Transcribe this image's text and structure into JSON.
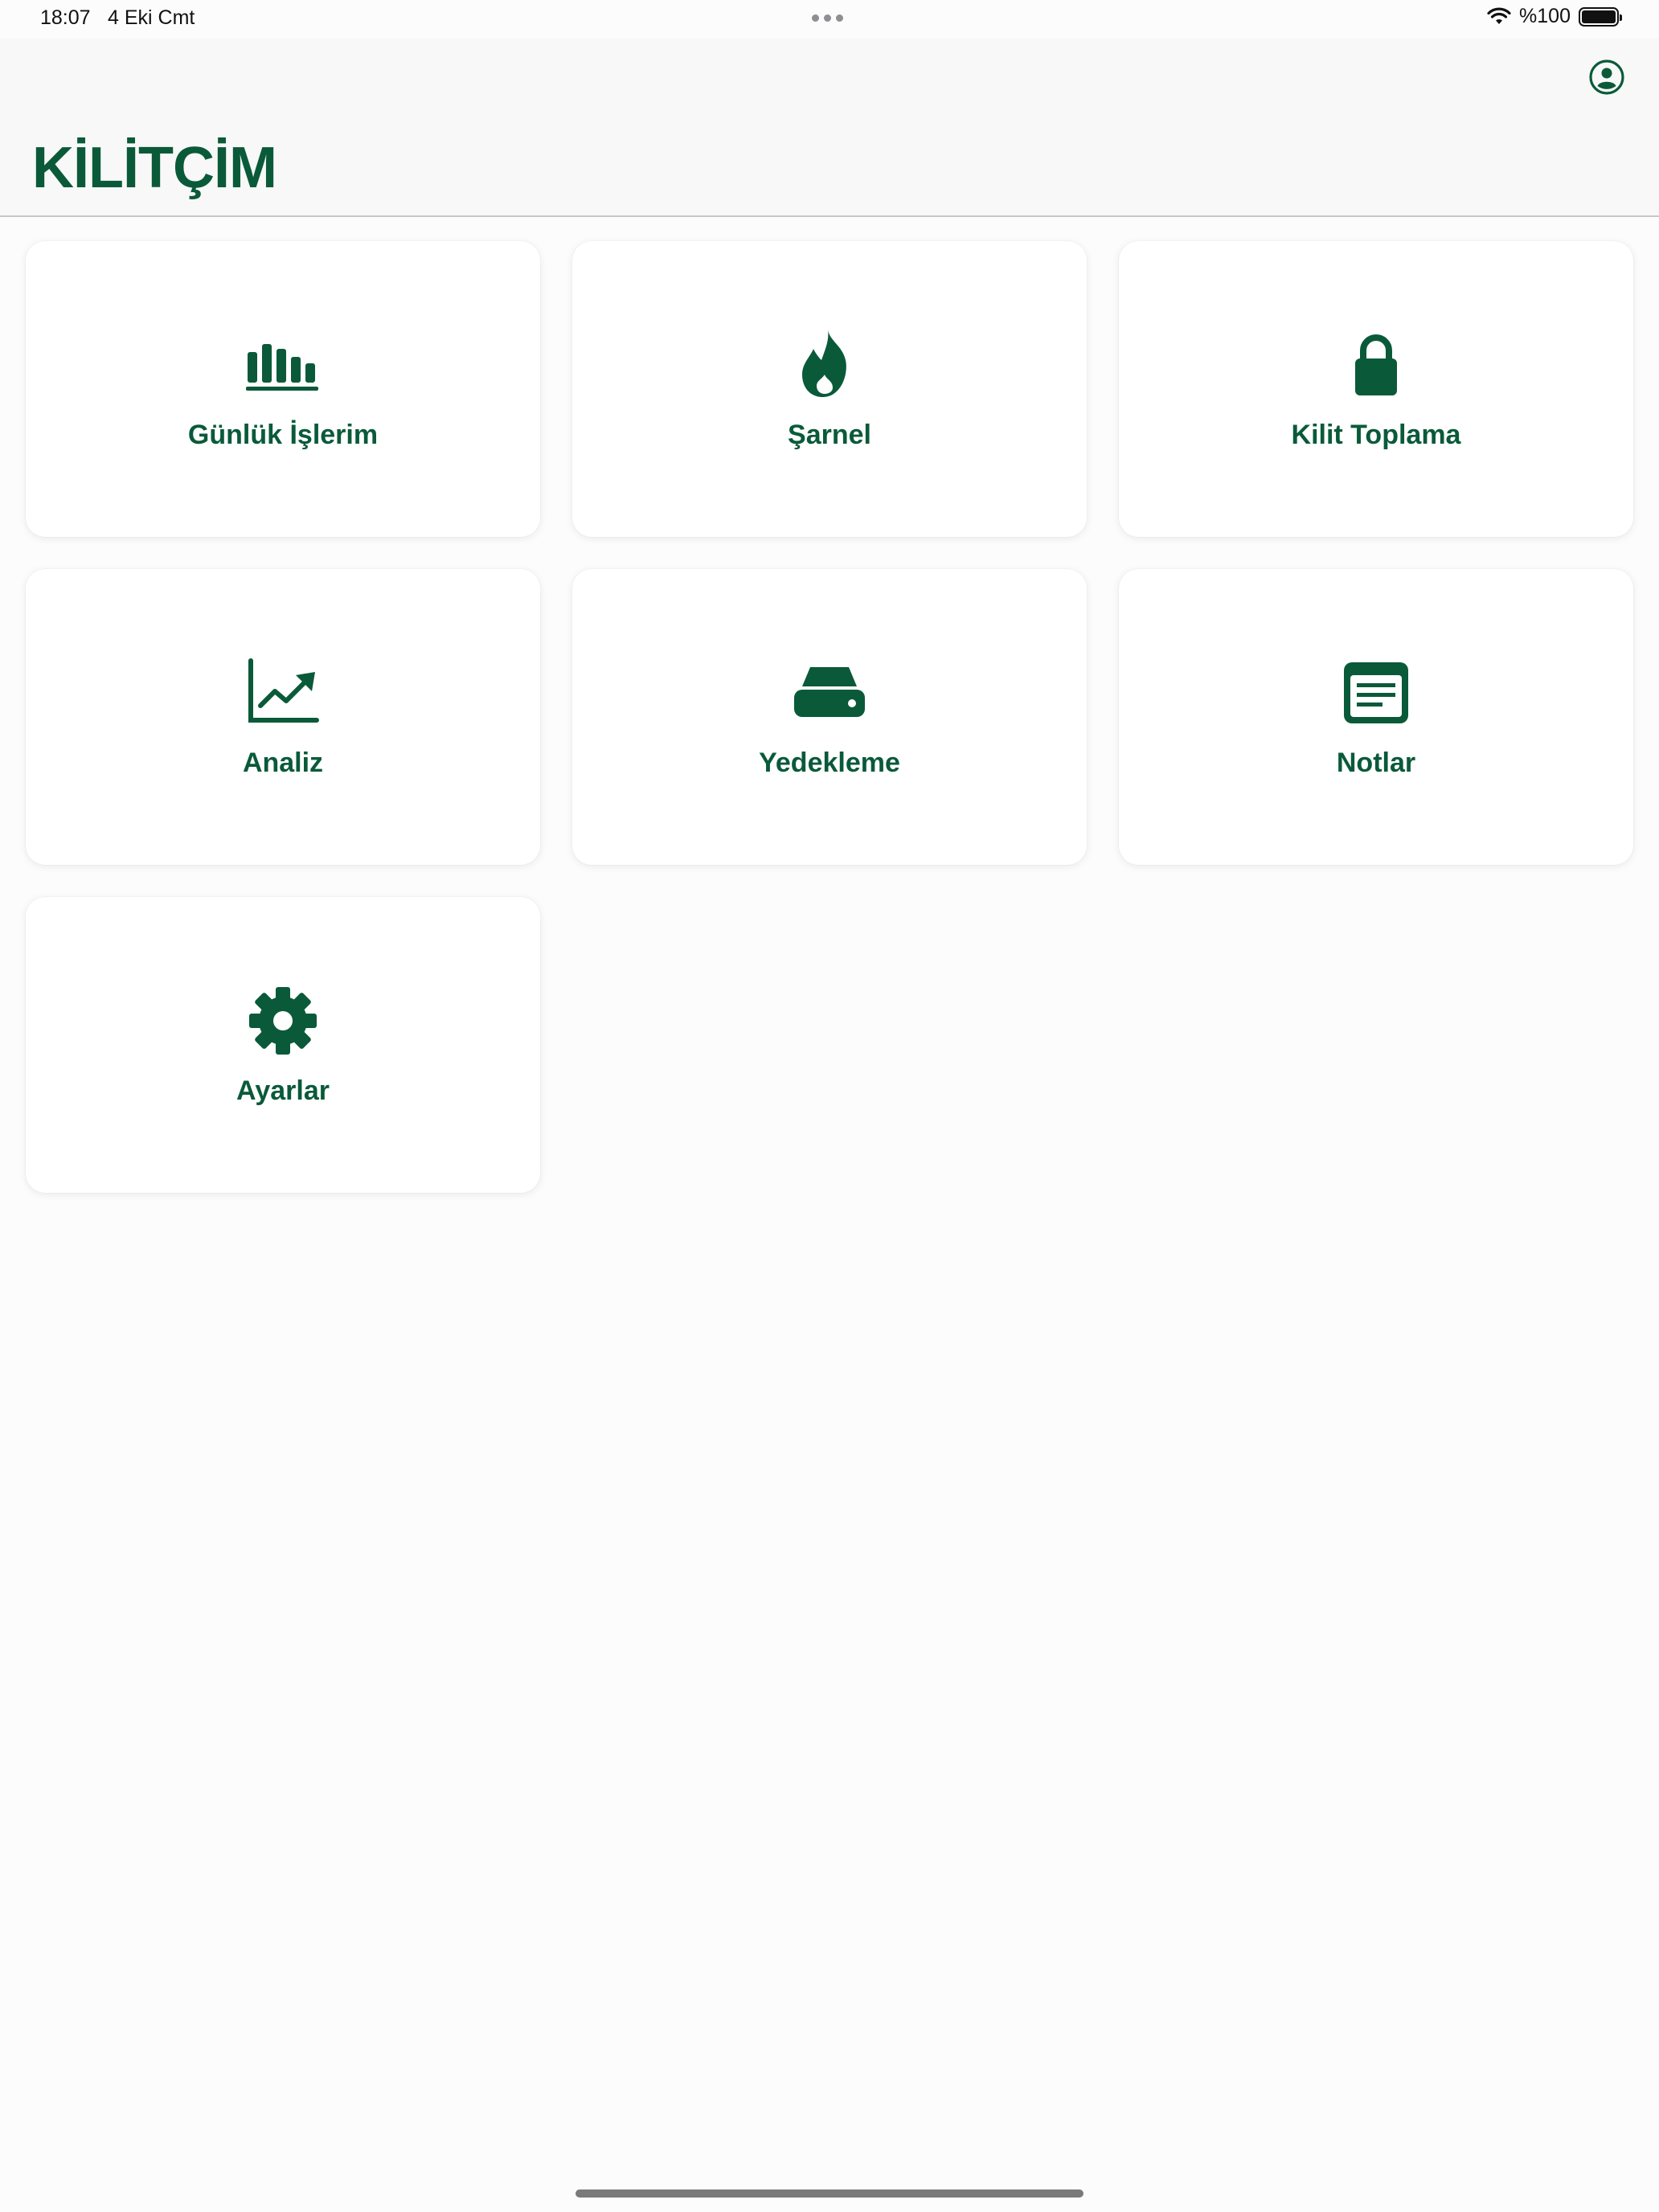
{
  "status_bar": {
    "time": "18:07",
    "date": "4 Eki Cmt",
    "battery": "%100",
    "battery_level": 1.0
  },
  "header": {
    "title": "KİLİTÇİM",
    "profile_icon": "person-circle-icon"
  },
  "theme": {
    "accent": "#0a5a3a",
    "background": "#fcfcfc",
    "card_background": "#ffffff"
  },
  "menu": [
    {
      "label": "Günlük İşlerim",
      "icon": "bar-chart-icon"
    },
    {
      "label": "Şarnel",
      "icon": "flame-icon"
    },
    {
      "label": "Kilit Toplama",
      "icon": "lock-icon"
    },
    {
      "label": "Analiz",
      "icon": "trending-up-chart-icon"
    },
    {
      "label": "Yedekleme",
      "icon": "hard-drive-icon"
    },
    {
      "label": "Notlar",
      "icon": "notes-icon"
    },
    {
      "label": "Ayarlar",
      "icon": "gear-icon"
    }
  ]
}
